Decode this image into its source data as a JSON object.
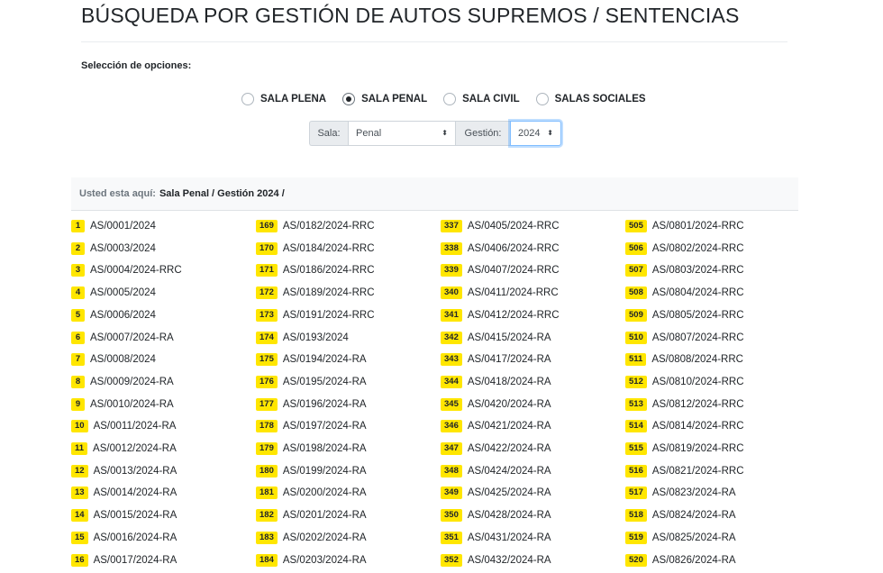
{
  "header": {
    "title": "BÚSQUEDA POR GESTIÓN DE AUTOS SUPREMOS / SENTENCIAS",
    "options_label": "Selección de opciones:"
  },
  "radios": [
    {
      "label": "SALA PLENA",
      "checked": false
    },
    {
      "label": "SALA PENAL",
      "checked": true
    },
    {
      "label": "SALA CIVIL",
      "checked": false
    },
    {
      "label": "SALAS SOCIALES",
      "checked": false
    }
  ],
  "filters": {
    "sala_label": "Sala:",
    "sala_value": "Penal",
    "gestion_label": "Gestión:",
    "gestion_value": "2024",
    "caret": "⬍"
  },
  "breadcrumb": {
    "prefix": "Usted esta aquí:",
    "path": "Sala Penal / Gestión 2024 /"
  },
  "columns": [
    [
      {
        "n": "1",
        "code": "AS/0001/2024"
      },
      {
        "n": "2",
        "code": "AS/0003/2024"
      },
      {
        "n": "3",
        "code": "AS/0004/2024-RRC"
      },
      {
        "n": "4",
        "code": "AS/0005/2024"
      },
      {
        "n": "5",
        "code": "AS/0006/2024"
      },
      {
        "n": "6",
        "code": "AS/0007/2024-RA"
      },
      {
        "n": "7",
        "code": "AS/0008/2024"
      },
      {
        "n": "8",
        "code": "AS/0009/2024-RA"
      },
      {
        "n": "9",
        "code": "AS/0010/2024-RA"
      },
      {
        "n": "10",
        "code": "AS/0011/2024-RA"
      },
      {
        "n": "11",
        "code": "AS/0012/2024-RA"
      },
      {
        "n": "12",
        "code": "AS/0013/2024-RA"
      },
      {
        "n": "13",
        "code": "AS/0014/2024-RA"
      },
      {
        "n": "14",
        "code": "AS/0015/2024-RA"
      },
      {
        "n": "15",
        "code": "AS/0016/2024-RA"
      },
      {
        "n": "16",
        "code": "AS/0017/2024-RA"
      }
    ],
    [
      {
        "n": "169",
        "code": "AS/0182/2024-RRC"
      },
      {
        "n": "170",
        "code": "AS/0184/2024-RRC"
      },
      {
        "n": "171",
        "code": "AS/0186/2024-RRC"
      },
      {
        "n": "172",
        "code": "AS/0189/2024-RRC"
      },
      {
        "n": "173",
        "code": "AS/0191/2024-RRC"
      },
      {
        "n": "174",
        "code": "AS/0193/2024"
      },
      {
        "n": "175",
        "code": "AS/0194/2024-RA"
      },
      {
        "n": "176",
        "code": "AS/0195/2024-RA"
      },
      {
        "n": "177",
        "code": "AS/0196/2024-RA"
      },
      {
        "n": "178",
        "code": "AS/0197/2024-RA"
      },
      {
        "n": "179",
        "code": "AS/0198/2024-RA"
      },
      {
        "n": "180",
        "code": "AS/0199/2024-RA"
      },
      {
        "n": "181",
        "code": "AS/0200/2024-RA"
      },
      {
        "n": "182",
        "code": "AS/0201/2024-RA"
      },
      {
        "n": "183",
        "code": "AS/0202/2024-RA"
      },
      {
        "n": "184",
        "code": "AS/0203/2024-RA"
      }
    ],
    [
      {
        "n": "337",
        "code": "AS/0405/2024-RRC"
      },
      {
        "n": "338",
        "code": "AS/0406/2024-RRC"
      },
      {
        "n": "339",
        "code": "AS/0407/2024-RRC"
      },
      {
        "n": "340",
        "code": "AS/0411/2024-RRC"
      },
      {
        "n": "341",
        "code": "AS/0412/2024-RRC"
      },
      {
        "n": "342",
        "code": "AS/0415/2024-RA"
      },
      {
        "n": "343",
        "code": "AS/0417/2024-RA"
      },
      {
        "n": "344",
        "code": "AS/0418/2024-RA"
      },
      {
        "n": "345",
        "code": "AS/0420/2024-RA"
      },
      {
        "n": "346",
        "code": "AS/0421/2024-RA"
      },
      {
        "n": "347",
        "code": "AS/0422/2024-RA"
      },
      {
        "n": "348",
        "code": "AS/0424/2024-RA"
      },
      {
        "n": "349",
        "code": "AS/0425/2024-RA"
      },
      {
        "n": "350",
        "code": "AS/0428/2024-RA"
      },
      {
        "n": "351",
        "code": "AS/0431/2024-RA"
      },
      {
        "n": "352",
        "code": "AS/0432/2024-RA"
      }
    ],
    [
      {
        "n": "505",
        "code": "AS/0801/2024-RRC"
      },
      {
        "n": "506",
        "code": "AS/0802/2024-RRC"
      },
      {
        "n": "507",
        "code": "AS/0803/2024-RRC"
      },
      {
        "n": "508",
        "code": "AS/0804/2024-RRC"
      },
      {
        "n": "509",
        "code": "AS/0805/2024-RRC"
      },
      {
        "n": "510",
        "code": "AS/0807/2024-RRC"
      },
      {
        "n": "511",
        "code": "AS/0808/2024-RRC"
      },
      {
        "n": "512",
        "code": "AS/0810/2024-RRC"
      },
      {
        "n": "513",
        "code": "AS/0812/2024-RRC"
      },
      {
        "n": "514",
        "code": "AS/0814/2024-RRC"
      },
      {
        "n": "515",
        "code": "AS/0819/2024-RRC"
      },
      {
        "n": "516",
        "code": "AS/0821/2024-RRC"
      },
      {
        "n": "517",
        "code": "AS/0823/2024-RA"
      },
      {
        "n": "518",
        "code": "AS/0824/2024-RA"
      },
      {
        "n": "519",
        "code": "AS/0825/2024-RA"
      },
      {
        "n": "520",
        "code": "AS/0826/2024-RA"
      }
    ]
  ]
}
